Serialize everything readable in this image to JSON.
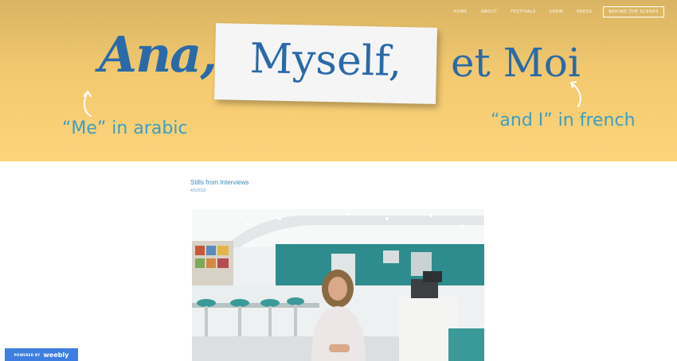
{
  "nav": {
    "items": [
      "HOME",
      "ABOUT",
      "FESTIVALS",
      "CREW",
      "PRESS"
    ],
    "cta": "BEHIND THE SCENES"
  },
  "hero": {
    "title_part1": "Ana,",
    "title_part2": "Myself,",
    "title_part3": "et Moi",
    "note_left": "“Me” in arabic",
    "note_right": "“and I” in french"
  },
  "post": {
    "title": "Stills from Interviews",
    "date": "4/5/2019"
  },
  "badge": {
    "powered": "POWERED BY",
    "brand": "weebly"
  },
  "colors": {
    "hero_bg": "#f2c96f",
    "title_blue": "#2a6aa8",
    "note_blue": "#3b9ec4",
    "badge_blue": "#3d7ee0"
  }
}
